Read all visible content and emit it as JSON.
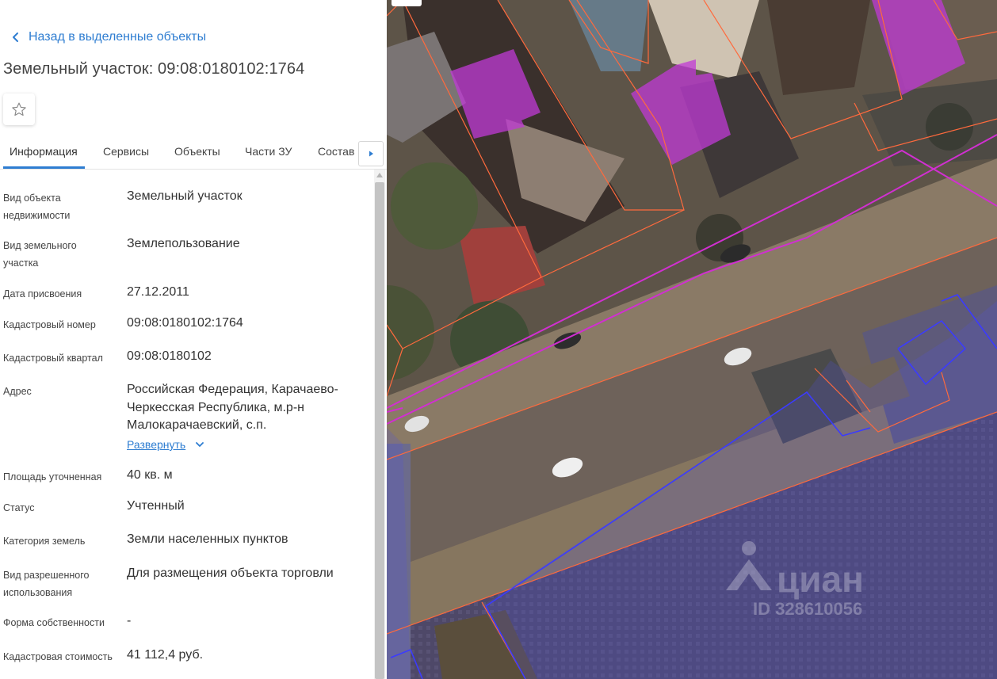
{
  "panel": {
    "back_label": "Назад в выделенные объекты",
    "title": "Земельный участок: 09:08:0180102:1764",
    "favorite_icon": "star-outline-icon",
    "tabs": [
      {
        "label": "Информация",
        "active": true
      },
      {
        "label": "Сервисы",
        "active": false
      },
      {
        "label": "Объекты",
        "active": false
      },
      {
        "label": "Части ЗУ",
        "active": false
      },
      {
        "label": "Состав",
        "active": false
      }
    ],
    "tabs_next_icon": "caret-right-icon",
    "accent_color": "#2e7dd1",
    "fields": [
      {
        "label": "Вид объекта недвижимости",
        "value": "Земельный участок"
      },
      {
        "label": "Вид земельного участка",
        "value": "Землепользование"
      },
      {
        "label": "Дата присвоения",
        "value": "27.12.2011"
      },
      {
        "label": "Кадастровый номер",
        "value": "09:08:0180102:1764"
      },
      {
        "label": "Кадастровый квартал",
        "value": "09:08:0180102"
      },
      {
        "label": "Адрес",
        "value": "Российская Федерация, Карачаево-Черкесская Республика, м.р-н Малокарачаевский, с.п."
      },
      {
        "label": "Площадь уточненная",
        "value": "40 кв. м"
      },
      {
        "label": "Статус",
        "value": "Учтенный"
      },
      {
        "label": "Категория земель",
        "value": "Земли населенных пунктов"
      },
      {
        "label": "Вид разрешенного использования",
        "value": "Для размещения объекта торговли"
      },
      {
        "label": "Форма собственности",
        "value": "-"
      },
      {
        "label": "Кадастровая стоимость",
        "value": "41 112,4 руб."
      }
    ],
    "expand_label": "Развернуть"
  },
  "map": {
    "watermark_logo": "циан",
    "watermark_id": "ID 328610056",
    "parcel_outline_color": "#ff6a3d",
    "selected_outline_color": "#d12fd1",
    "purple_fill_color": "#c03ad6",
    "blue_outline_color": "#3b3bff"
  }
}
